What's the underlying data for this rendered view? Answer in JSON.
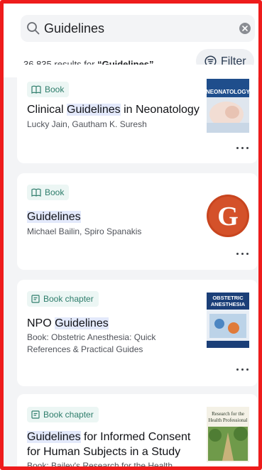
{
  "search": {
    "query": "Guidelines"
  },
  "results": {
    "count": "36,835",
    "text_before": "results for ",
    "term": "“Guidelines”"
  },
  "filter": {
    "label": "Filter"
  },
  "cards": [
    {
      "type": "Book",
      "title_parts": [
        "Clinical ",
        "Guidelines",
        " in Neonatology"
      ],
      "authors": "Lucky Jain, Gautham K. Suresh",
      "cover_text": "NEONATOLOGY"
    },
    {
      "type": "Book",
      "title_parts": [
        "",
        "Guidelines",
        ""
      ],
      "authors": "Michael Bailin, Spiro Spanakis",
      "cover_text": "G"
    },
    {
      "type": "Book chapter",
      "title_parts": [
        "NPO ",
        "Guidelines",
        ""
      ],
      "authors": "Book: Obstetric Anesthesia: Quick References & Practical Guides",
      "cover_text": "OBSTETRIC ANESTHESIA"
    },
    {
      "type": "Book chapter",
      "title_parts": [
        "",
        "Guidelines",
        " for Informed Consent for Human Subjects in a Study"
      ],
      "authors": "Book: Bailey's Research for the Health",
      "cover_text": "Research for the Health Professional"
    }
  ],
  "colors": {
    "frame": "#ee1c1c",
    "tag_text": "#2e7d6b",
    "highlight": "#e3e9fb"
  }
}
